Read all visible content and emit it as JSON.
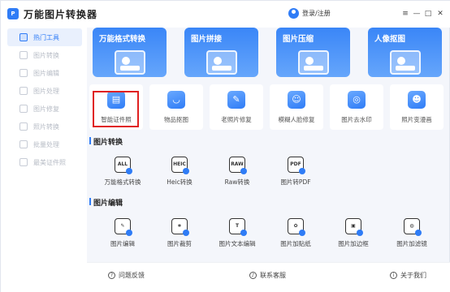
{
  "app": {
    "title": "万能图片转换器",
    "login_label": "登录/注册"
  },
  "window_controls": {
    "menu": "≡",
    "minimize": "—",
    "maximize": "□",
    "close": "✕"
  },
  "sidebar": {
    "items": [
      {
        "label": "热门工具",
        "active": true
      },
      {
        "label": "图片转换"
      },
      {
        "label": "图片编辑"
      },
      {
        "label": "图片处理"
      },
      {
        "label": "图片修复"
      },
      {
        "label": "照片转换"
      },
      {
        "label": "批量处理"
      },
      {
        "label": "最美证件照"
      }
    ]
  },
  "banners": [
    {
      "label": "万能格式转换"
    },
    {
      "label": "图片拼接"
    },
    {
      "label": "图片压缩"
    },
    {
      "label": "人像抠图"
    }
  ],
  "tools": [
    {
      "label": "智能证件照",
      "icon": "id-card-icon",
      "glyph": "▤"
    },
    {
      "label": "物品抠图",
      "icon": "bag-icon",
      "glyph": "◡"
    },
    {
      "label": "老照片修复",
      "icon": "repair-icon",
      "glyph": "✎"
    },
    {
      "label": "模糊人脸修复",
      "icon": "face-icon",
      "glyph": "☺"
    },
    {
      "label": "图片去水印",
      "icon": "watermark-icon",
      "glyph": "◎"
    },
    {
      "label": "照片变漫画",
      "icon": "cartoon-icon",
      "glyph": "☻"
    }
  ],
  "sections": {
    "convert": {
      "title": "图片转换",
      "items": [
        {
          "label": "万能格式转换",
          "badge": "ALL"
        },
        {
          "label": "Heic转换",
          "badge": "HEIC"
        },
        {
          "label": "Raw转换",
          "badge": "RAW"
        },
        {
          "label": "图片转PDF",
          "badge": "PDF"
        }
      ]
    },
    "edit": {
      "title": "图片编辑",
      "items": [
        {
          "label": "图片编辑",
          "badge": "✎"
        },
        {
          "label": "图片裁剪",
          "badge": "⌗"
        },
        {
          "label": "图片文本编辑",
          "badge": "T"
        },
        {
          "label": "图片加贴纸",
          "badge": "✿"
        },
        {
          "label": "图片加边框",
          "badge": "▣"
        },
        {
          "label": "图片加滤镜",
          "badge": "◍"
        }
      ]
    }
  },
  "footer": {
    "feedback": "问题反馈",
    "contact": "联系客服",
    "about": "关于我们"
  },
  "colors": {
    "accent": "#2f7cf6",
    "highlight": "#e02020"
  }
}
